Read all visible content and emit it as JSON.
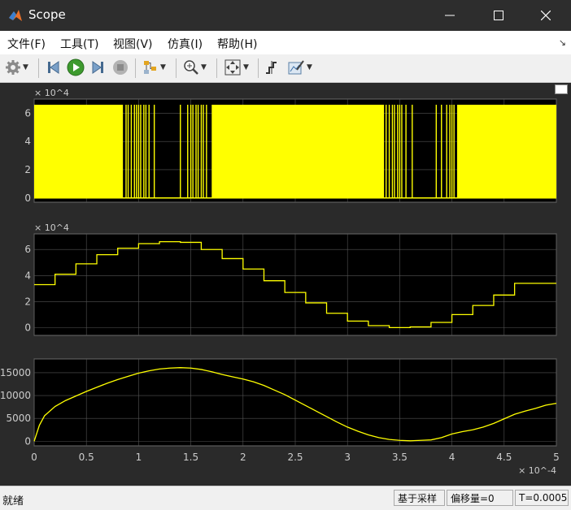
{
  "window": {
    "title": "Scope"
  },
  "menu": [
    "文件(F)",
    "工具(T)",
    "视图(V)",
    "仿真(I)",
    "帮助(H)"
  ],
  "toolbar": {
    "icons": [
      "gear-icon",
      "step-back-icon",
      "run-icon",
      "step-forward-icon",
      "stop-icon",
      "highlight-block-icon",
      "zoom-icon",
      "fit-to-view-icon",
      "cursor-measure-icon",
      "style-icon"
    ]
  },
  "colors": {
    "signal": "#ffff00",
    "axes_bg": "#000000",
    "figure_bg": "#2a2a2a",
    "grid": "#555555",
    "tick_text": "#cccccc"
  },
  "chart_data": [
    {
      "type": "line",
      "panel": "top",
      "y_multiplier": "× 10^4",
      "y_ticks": [
        "0",
        "2",
        "4",
        "6"
      ],
      "ylim": [
        -0.3,
        7.0
      ],
      "xlim": [
        0,
        5
      ],
      "note": "dense switching between 0 and ~6.6 (×10^4); sparse gaps near x≈1.2–1.45 and x≈3.6–3.9",
      "levels": [
        0,
        6.6
      ]
    },
    {
      "type": "line",
      "panel": "middle",
      "y_multiplier": "× 10^4",
      "y_ticks": [
        "0",
        "2",
        "4",
        "6"
      ],
      "ylim": [
        -0.6,
        7.2
      ],
      "xlim": [
        0,
        5
      ],
      "x": [
        0,
        0.2,
        0.4,
        0.6,
        0.8,
        1.0,
        1.2,
        1.4,
        1.6,
        1.8,
        2.0,
        2.2,
        2.4,
        2.6,
        2.8,
        3.0,
        3.2,
        3.4,
        3.6,
        3.8,
        4.0,
        4.2,
        4.4,
        4.6,
        4.8,
        5.0
      ],
      "y": [
        3.3,
        4.1,
        4.9,
        5.6,
        6.1,
        6.45,
        6.6,
        6.55,
        6.0,
        5.3,
        4.5,
        3.6,
        2.7,
        1.9,
        1.1,
        0.5,
        0.15,
        0.0,
        0.05,
        0.4,
        1.0,
        1.7,
        2.5,
        3.4,
        3.4,
        3.4
      ]
    },
    {
      "type": "line",
      "panel": "bottom",
      "y_ticks": [
        "0",
        "5000",
        "10000",
        "15000"
      ],
      "ylim": [
        -1000,
        18000
      ],
      "xlim": [
        0,
        5
      ],
      "x_ticks": [
        "0",
        "0.5",
        "1",
        "1.5",
        "2",
        "2.5",
        "3",
        "3.5",
        "4",
        "4.5",
        "5"
      ],
      "x_multiplier": "× 10^-4",
      "x": [
        0,
        0.05,
        0.1,
        0.2,
        0.3,
        0.4,
        0.5,
        0.6,
        0.7,
        0.8,
        0.9,
        1.0,
        1.1,
        1.2,
        1.3,
        1.4,
        1.5,
        1.6,
        1.7,
        1.8,
        1.9,
        2.0,
        2.1,
        2.2,
        2.3,
        2.4,
        2.5,
        2.6,
        2.7,
        2.8,
        2.9,
        3.0,
        3.1,
        3.2,
        3.3,
        3.4,
        3.5,
        3.6,
        3.7,
        3.8,
        3.9,
        4.0,
        4.1,
        4.2,
        4.3,
        4.4,
        4.5,
        4.6,
        4.7,
        4.8,
        4.9,
        5.0
      ],
      "y": [
        0,
        3500,
        5600,
        7600,
        8900,
        9900,
        10900,
        11800,
        12700,
        13500,
        14200,
        14900,
        15400,
        15800,
        16000,
        16100,
        16000,
        15700,
        15200,
        14600,
        14100,
        13600,
        13000,
        12200,
        11200,
        10200,
        9000,
        7800,
        6600,
        5400,
        4200,
        3100,
        2200,
        1400,
        800,
        400,
        200,
        100,
        200,
        300,
        800,
        1600,
        2100,
        2500,
        3100,
        3900,
        4900,
        5900,
        6600,
        7200,
        7900,
        8300
      ]
    }
  ],
  "status": {
    "left": "就绪",
    "mode": "基于采样",
    "offset": "偏移量=0",
    "time": "T=0.0005"
  }
}
